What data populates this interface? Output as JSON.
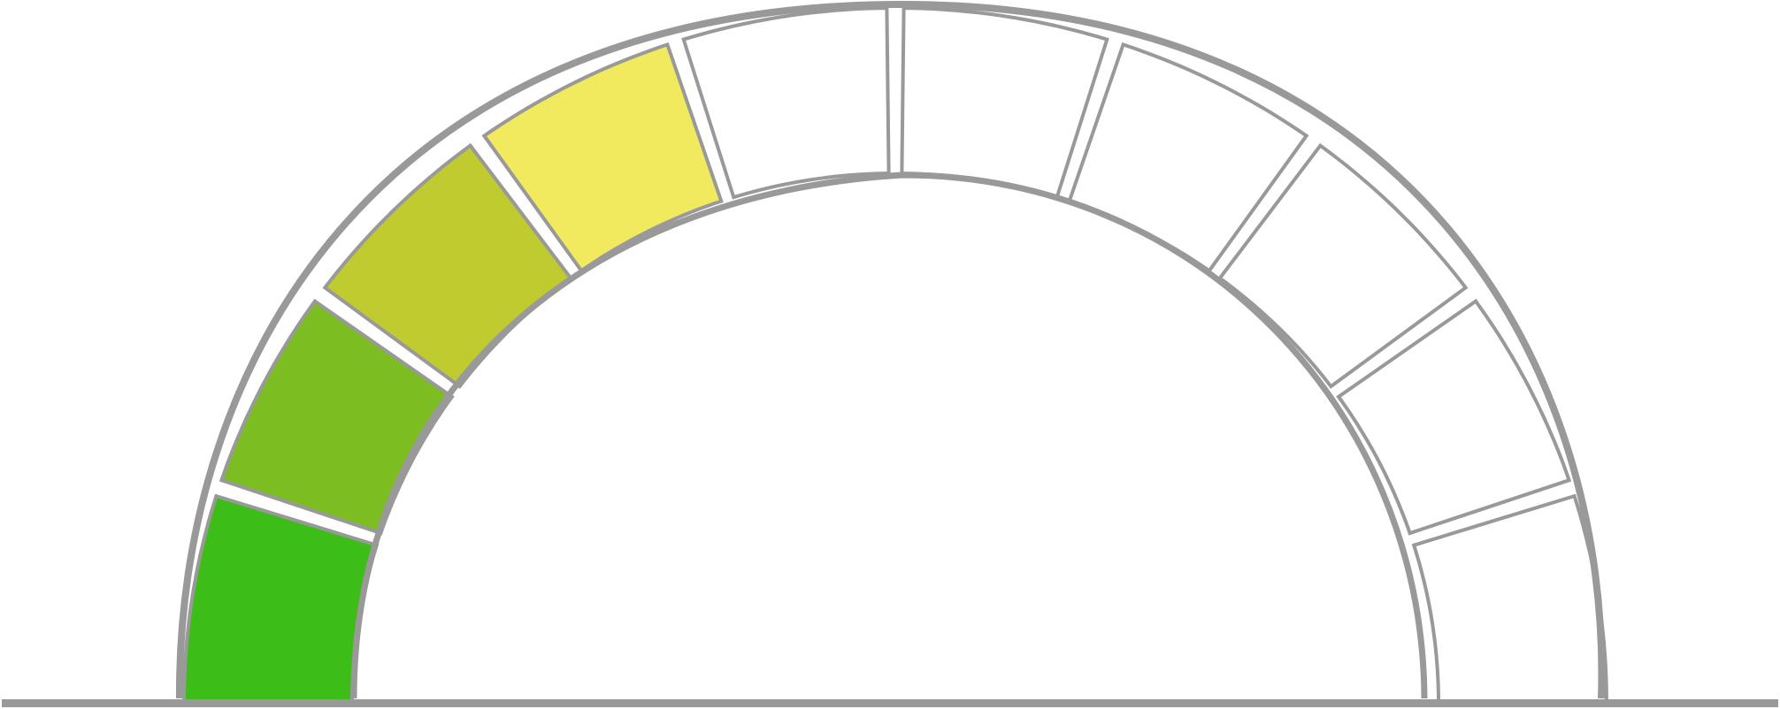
{
  "gauge": {
    "segment_count": 10,
    "filled_segments": 4,
    "filled_fraction": 0.4,
    "segment_colors": [
      "#3dbd17",
      "#7cbd21",
      "#c0cb30",
      "#f2ea5e",
      "#ffffff",
      "#ffffff",
      "#ffffff",
      "#ffffff",
      "#ffffff",
      "#ffffff"
    ],
    "empty_color": "#ffffff",
    "outline_color": "#999999",
    "baseline_color": "#999999"
  }
}
